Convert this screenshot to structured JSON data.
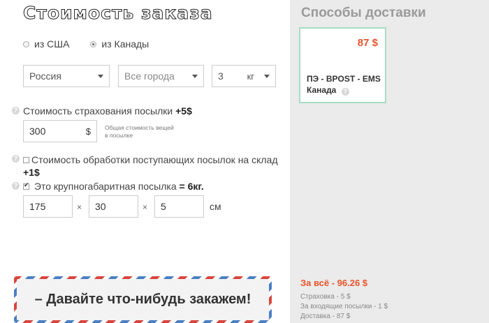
{
  "order": {
    "title": "Стоимость заказа",
    "origin": {
      "options": [
        {
          "label": "из США",
          "selected": false
        },
        {
          "label": "из Канады",
          "selected": true
        }
      ]
    },
    "country": "Россия",
    "city": "Все города",
    "weight": {
      "value": "3",
      "unit": "кг"
    },
    "insurance": {
      "label": "Стоимость страхования посылки",
      "extra": "+5$",
      "value": "300",
      "currency": "$",
      "hint": "Общая стоимость вещей в посылке"
    },
    "processing": {
      "label": "Стоимость обработки поступающих посылок на склад",
      "extra": "+1$",
      "checked": false
    },
    "oversize": {
      "label": "Это крупногабаритная посылка",
      "extra": "= 6кг.",
      "checked": true,
      "length": "175",
      "width": "30",
      "height": "5",
      "separator": "×",
      "unit": "см"
    },
    "submit_label": "– Давайте что-нибудь закажем!"
  },
  "delivery": {
    "title": "Способы доставки",
    "methods": [
      {
        "price": "87 $",
        "name": "ПЭ - BPOST - EMS Канада"
      }
    ],
    "total": "За всё - 96.26 $",
    "breakdown": [
      "Страховка - 5 $",
      "За входящие посылки - 1 $",
      "Доставка - 87 $"
    ]
  },
  "colors": {
    "accent": "#e8542c",
    "card_border": "#a8dcc4",
    "sidebar_bg": "#ebebeb"
  }
}
